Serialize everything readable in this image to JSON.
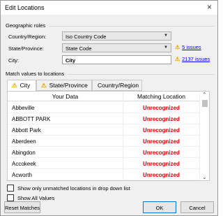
{
  "window": {
    "title": "Edit Locations",
    "close_glyph": "×"
  },
  "geo_roles": {
    "section_label": "Geographic roles",
    "country": {
      "label": "Country/Region:",
      "value": "Iso Country Code"
    },
    "state": {
      "label": "State/Province:",
      "value": "State Code",
      "issues_link": "5 issues"
    },
    "city": {
      "label": "City:",
      "value": "City",
      "issues_link": "2137 issues"
    }
  },
  "match_section": {
    "label": "Match values to locations",
    "tabs": [
      {
        "label": "City",
        "warning": true,
        "active": true
      },
      {
        "label": "State/Province",
        "warning": true,
        "active": false
      },
      {
        "label": "Country/Region",
        "warning": false,
        "active": false
      }
    ],
    "columns": [
      "Your Data",
      "Matching Location"
    ],
    "rows": [
      {
        "data": "Abbeville",
        "match": "Unrecognized"
      },
      {
        "data": "ABBOTT PARK",
        "match": "Unrecognized"
      },
      {
        "data": "Abbott Park",
        "match": "Unrecognized"
      },
      {
        "data": "Aberdeen",
        "match": "Unrecognized"
      },
      {
        "data": "Abingdon",
        "match": "Unrecognized"
      },
      {
        "data": "Accokeek",
        "match": "Unrecognized"
      },
      {
        "data": "Acworth",
        "match": "Unrecognized"
      }
    ]
  },
  "options": {
    "show_unmatched": "Show only unmatched locations in drop down list",
    "show_all": "Show All Values"
  },
  "buttons": {
    "reset": "Reset Matches",
    "ok": "OK",
    "cancel": "Cancel"
  },
  "colors": {
    "warning": "#e8a000",
    "unrecognized": "#e00000",
    "link": "#0000ee",
    "default_button_border": "#0078d7"
  },
  "icons": {
    "warning": "warning-triangle-icon",
    "dropdown": "chevron-down-icon",
    "close": "close-icon"
  }
}
